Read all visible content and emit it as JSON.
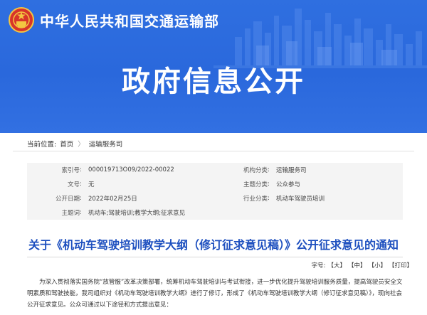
{
  "header": {
    "ministry_name": "中华人民共和国交通运输部",
    "banner_title": "政府信息公开"
  },
  "breadcrumb": {
    "label": "当前位置:",
    "items": [
      "首页",
      "运输服务司"
    ],
    "separator": "〉"
  },
  "meta": {
    "index_label": "索引号",
    "index_value": "000019713O09/2022-00022",
    "org_label": "机构分类",
    "org_value": "运输服务司",
    "docno_label": "文号",
    "docno_value": "无",
    "theme_label": "主题分类",
    "theme_value": "公众参与",
    "date_label": "公开日期",
    "date_value": "2022年02月25日",
    "industry_label": "行业分类",
    "industry_value": "机动车驾驶员培训",
    "keywords_label": "主题词",
    "keywords_value": "机动车;驾驶培训;教学大纲;征求意见",
    "colon": ":"
  },
  "document": {
    "title": "关于《机动车驾驶培训教学大纲（修订征求意见稿）》公开征求意见的通知",
    "fontsize": {
      "label": "字号:",
      "large": "【大】",
      "medium": "【中】",
      "small": "【小】",
      "print": "【打印】"
    },
    "paragraph": "为深入贯彻落实国务院“放管服”改革决策部署，统筹机动车驾驶培训与考试衔接，进一步优化提升驾驶培训服务质量，提高驾驶员安全文明素质和驾驶技能，我司组织对《机动车驾驶培训教学大纲》进行了修订，形成了《机动车驾驶培训教学大纲（修订征求意见稿）》，现向社会公开征求意见。公众可通过以下途径和方式提出意见："
  },
  "colors": {
    "banner": "#2f6fe0",
    "title": "#1d4fbf"
  }
}
